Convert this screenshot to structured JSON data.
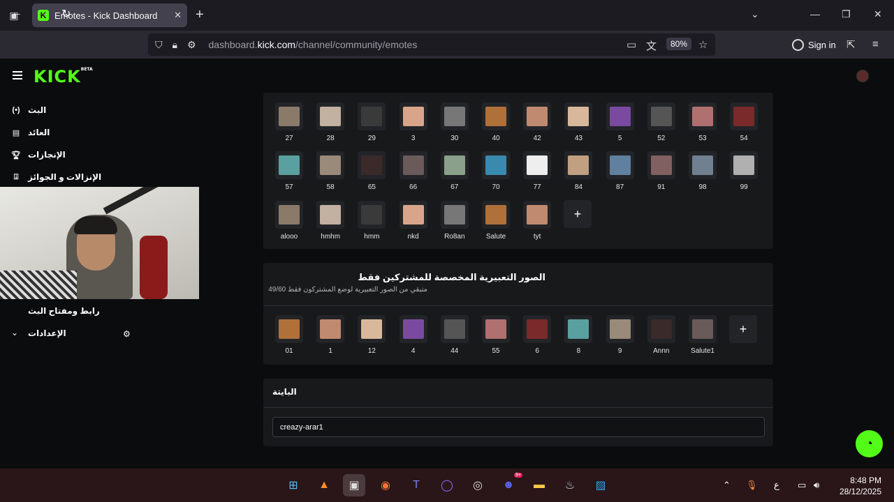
{
  "browser": {
    "tab_title": "Emotes - Kick Dashboard",
    "tab_favicon_letter": "K",
    "url_host_prefix": "dashboard.",
    "url_host": "kick.com",
    "url_path": "/channel/community/emotes",
    "zoom": "80%",
    "sign_in": "Sign in"
  },
  "brand": {
    "logo": "KICK",
    "beta": "BETA",
    "accent": "#53fc18"
  },
  "sidebar": {
    "items": [
      {
        "label": "البث",
        "icon": "broadcast-icon"
      },
      {
        "label": "العائد",
        "icon": "revenue-icon"
      },
      {
        "label": "الإنجازات",
        "icon": "trophy-icon"
      },
      {
        "label": "الإنزالات و الجوائز",
        "icon": "drops-icon"
      },
      {
        "label": "رابط ومفتاح البث",
        "icon": "key-icon"
      },
      {
        "label": "الإعدادات",
        "icon": "gear-icon"
      }
    ]
  },
  "channel_emotes": {
    "row1": [
      "27",
      "28",
      "29",
      "3",
      "30",
      "40",
      "42",
      "43",
      "5",
      "52",
      "53",
      "54"
    ],
    "row2": [
      "57",
      "58",
      "65",
      "66",
      "67",
      "70",
      "77",
      "84",
      "87",
      "91",
      "98",
      "99"
    ],
    "row3": [
      "alooo",
      "hmhm",
      "hmm",
      "nkd",
      "Ro8an",
      "Salute",
      "tyt"
    ]
  },
  "subscriber_emotes": {
    "title": "الصور التعبيرية المخصصة للمشتركين فقط",
    "subtitle": "متبقي من الصور التعبيرية لوضع المشتركون فقط 49/60",
    "items": [
      "01",
      "1",
      "12",
      "4",
      "44",
      "55",
      "6",
      "8",
      "9",
      "Annn",
      "Salute1"
    ]
  },
  "bait": {
    "title": "البايتة",
    "input_value": "creazy-arar1"
  },
  "taskbar": {
    "ime": "ع",
    "time": "8:48 PM",
    "date": "28/12/2025",
    "discord_badge": "9+"
  }
}
